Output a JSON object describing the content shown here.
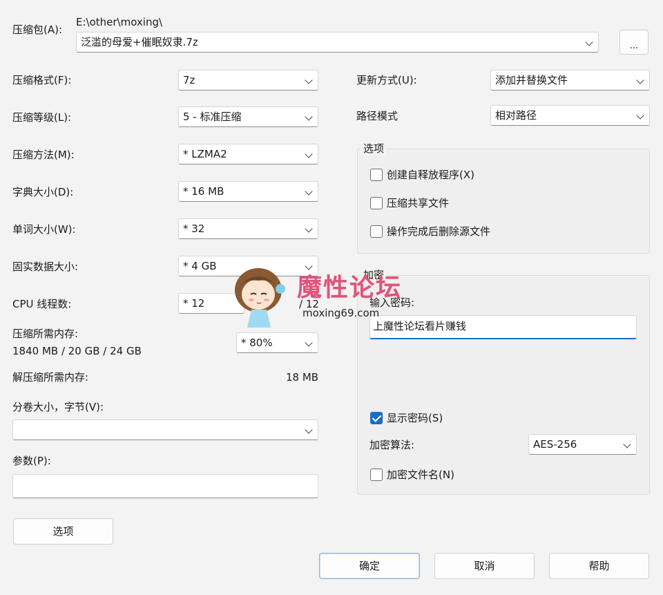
{
  "archive": {
    "label": "压缩包(A):",
    "path": "E:\\other\\moxing\\",
    "filename": "泛滥的母爱+催眠奴隶.7z",
    "browse_label": "..."
  },
  "left": {
    "format": {
      "label": "压缩格式(F):",
      "value": "7z"
    },
    "level": {
      "label": "压缩等级(L):",
      "value": "5 - 标准压缩"
    },
    "method": {
      "label": "压缩方法(M):",
      "value": "*  LZMA2"
    },
    "dict": {
      "label": "字典大小(D):",
      "value": "*  16 MB"
    },
    "word": {
      "label": "单词大小(W):",
      "value": "*  32"
    },
    "solid": {
      "label": "固实数据大小:",
      "value": "*  4 GB"
    },
    "threads": {
      "label": "CPU 线程数:",
      "value": "*  12",
      "max": "/ 12"
    },
    "memory": {
      "label": "压缩所需内存:",
      "detail": "1840 MB / 20 GB / 24 GB",
      "value": "* 80%"
    },
    "decomp": {
      "label": "解压缩所需内存:",
      "value": "18 MB"
    },
    "volume": {
      "label": "分卷大小，字节(V):",
      "value": ""
    },
    "params": {
      "label": "参数(P):",
      "value": ""
    },
    "options_button": "选项"
  },
  "right": {
    "update": {
      "label": "更新方式(U):",
      "value": "添加并替换文件"
    },
    "pathmode": {
      "label": "路径模式",
      "value": "相对路径"
    },
    "options": {
      "title": "选项",
      "sfx": "创建自释放程序(X)",
      "shared": "压缩共享文件",
      "delete": "操作完成后删除源文件"
    },
    "encryption": {
      "title": "加密",
      "password_label": "输入密码:",
      "password_value": "上魔性论坛看片赚钱",
      "show_password": "显示密码(S)",
      "method_label": "加密算法:",
      "method_value": "AES-256",
      "encrypt_names": "加密文件名(N)"
    }
  },
  "watermark": {
    "text": "魔性论坛",
    "url": "moxing69.com"
  },
  "buttons": {
    "ok": "确定",
    "cancel": "取消",
    "help": "帮助"
  }
}
